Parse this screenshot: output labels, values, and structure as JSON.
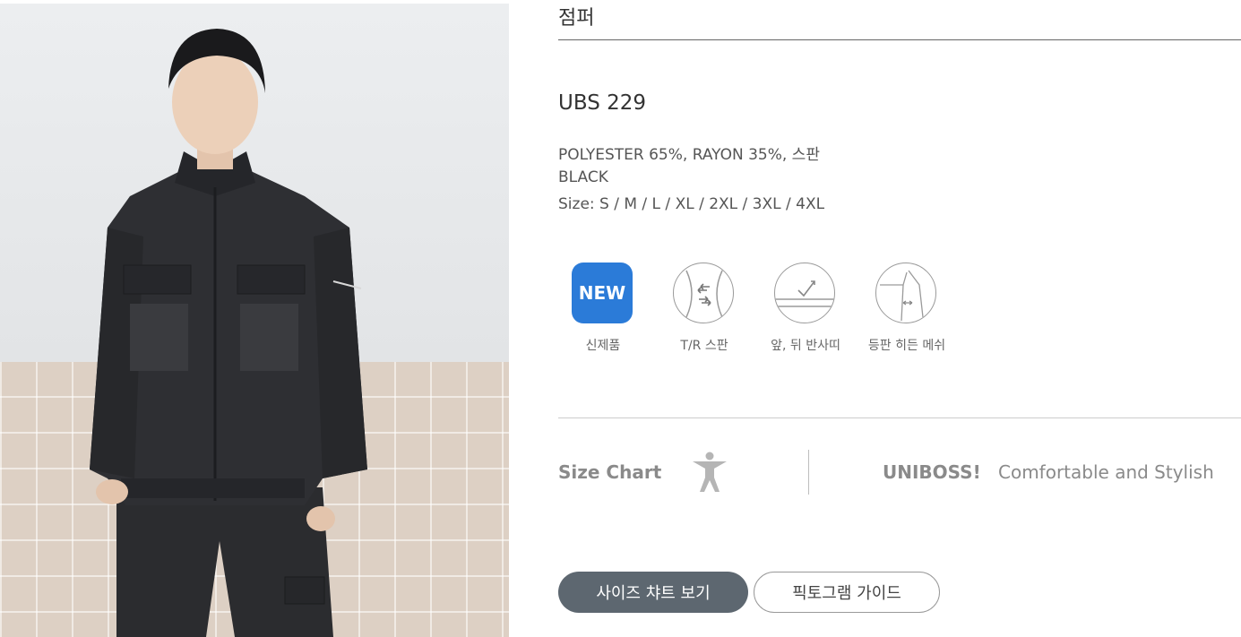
{
  "product": {
    "title": "점퍼",
    "model": "UBS 229",
    "material": "POLYESTER 65%, RAYON 35%, 스판",
    "color": "BLACK",
    "size": "Size: S / M / L / XL / 2XL / 3XL / 4XL"
  },
  "features": [
    {
      "label": "신제품",
      "icon": "new-badge-icon",
      "text": "NEW",
      "accent": "#2b7bd8"
    },
    {
      "label": "T/R 스판",
      "icon": "stretch-fabric-icon"
    },
    {
      "label": "앞, 뒤 반사띠",
      "icon": "reflective-tape-icon"
    },
    {
      "label": "등판 히든 메쉬",
      "icon": "hidden-mesh-icon"
    }
  ],
  "size_chart": {
    "label": "Size Chart",
    "icon": "person-icon"
  },
  "brand": {
    "name": "UNIBOSS!",
    "slogan": "Comfortable and Stylish"
  },
  "buttons": {
    "size_chart": "사이즈 챠트 보기",
    "pictogram_guide": "픽토그램 가이드"
  },
  "colors": {
    "primary_button": "#5d6770",
    "new_badge": "#2b7bd8"
  }
}
